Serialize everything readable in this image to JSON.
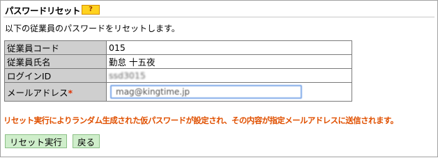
{
  "header": {
    "title": "パスワードリセット",
    "help_label": "?"
  },
  "description": "以下の従業員のパスワードをリセットします。",
  "form": {
    "rows": [
      {
        "label": "従業員コード",
        "value": "015"
      },
      {
        "label": "従業員氏名",
        "value": "勤怠 十五夜"
      },
      {
        "label": "ログインID",
        "value": "ssd3015"
      },
      {
        "label": "メールアドレス",
        "required_mark": "*",
        "input_value": "mag@kingtime.jp"
      }
    ]
  },
  "notice": "リセット実行によりランダム生成された仮パスワードが設定され、その内容が指定メールアドレスに送信されます。",
  "buttons": {
    "execute_label": "リセット実行",
    "back_label": "戻る"
  },
  "colors": {
    "notice": "#e05000",
    "required": "#e03000",
    "button_bg": "#cfeecb",
    "label_bg": "#cfcfcf"
  }
}
